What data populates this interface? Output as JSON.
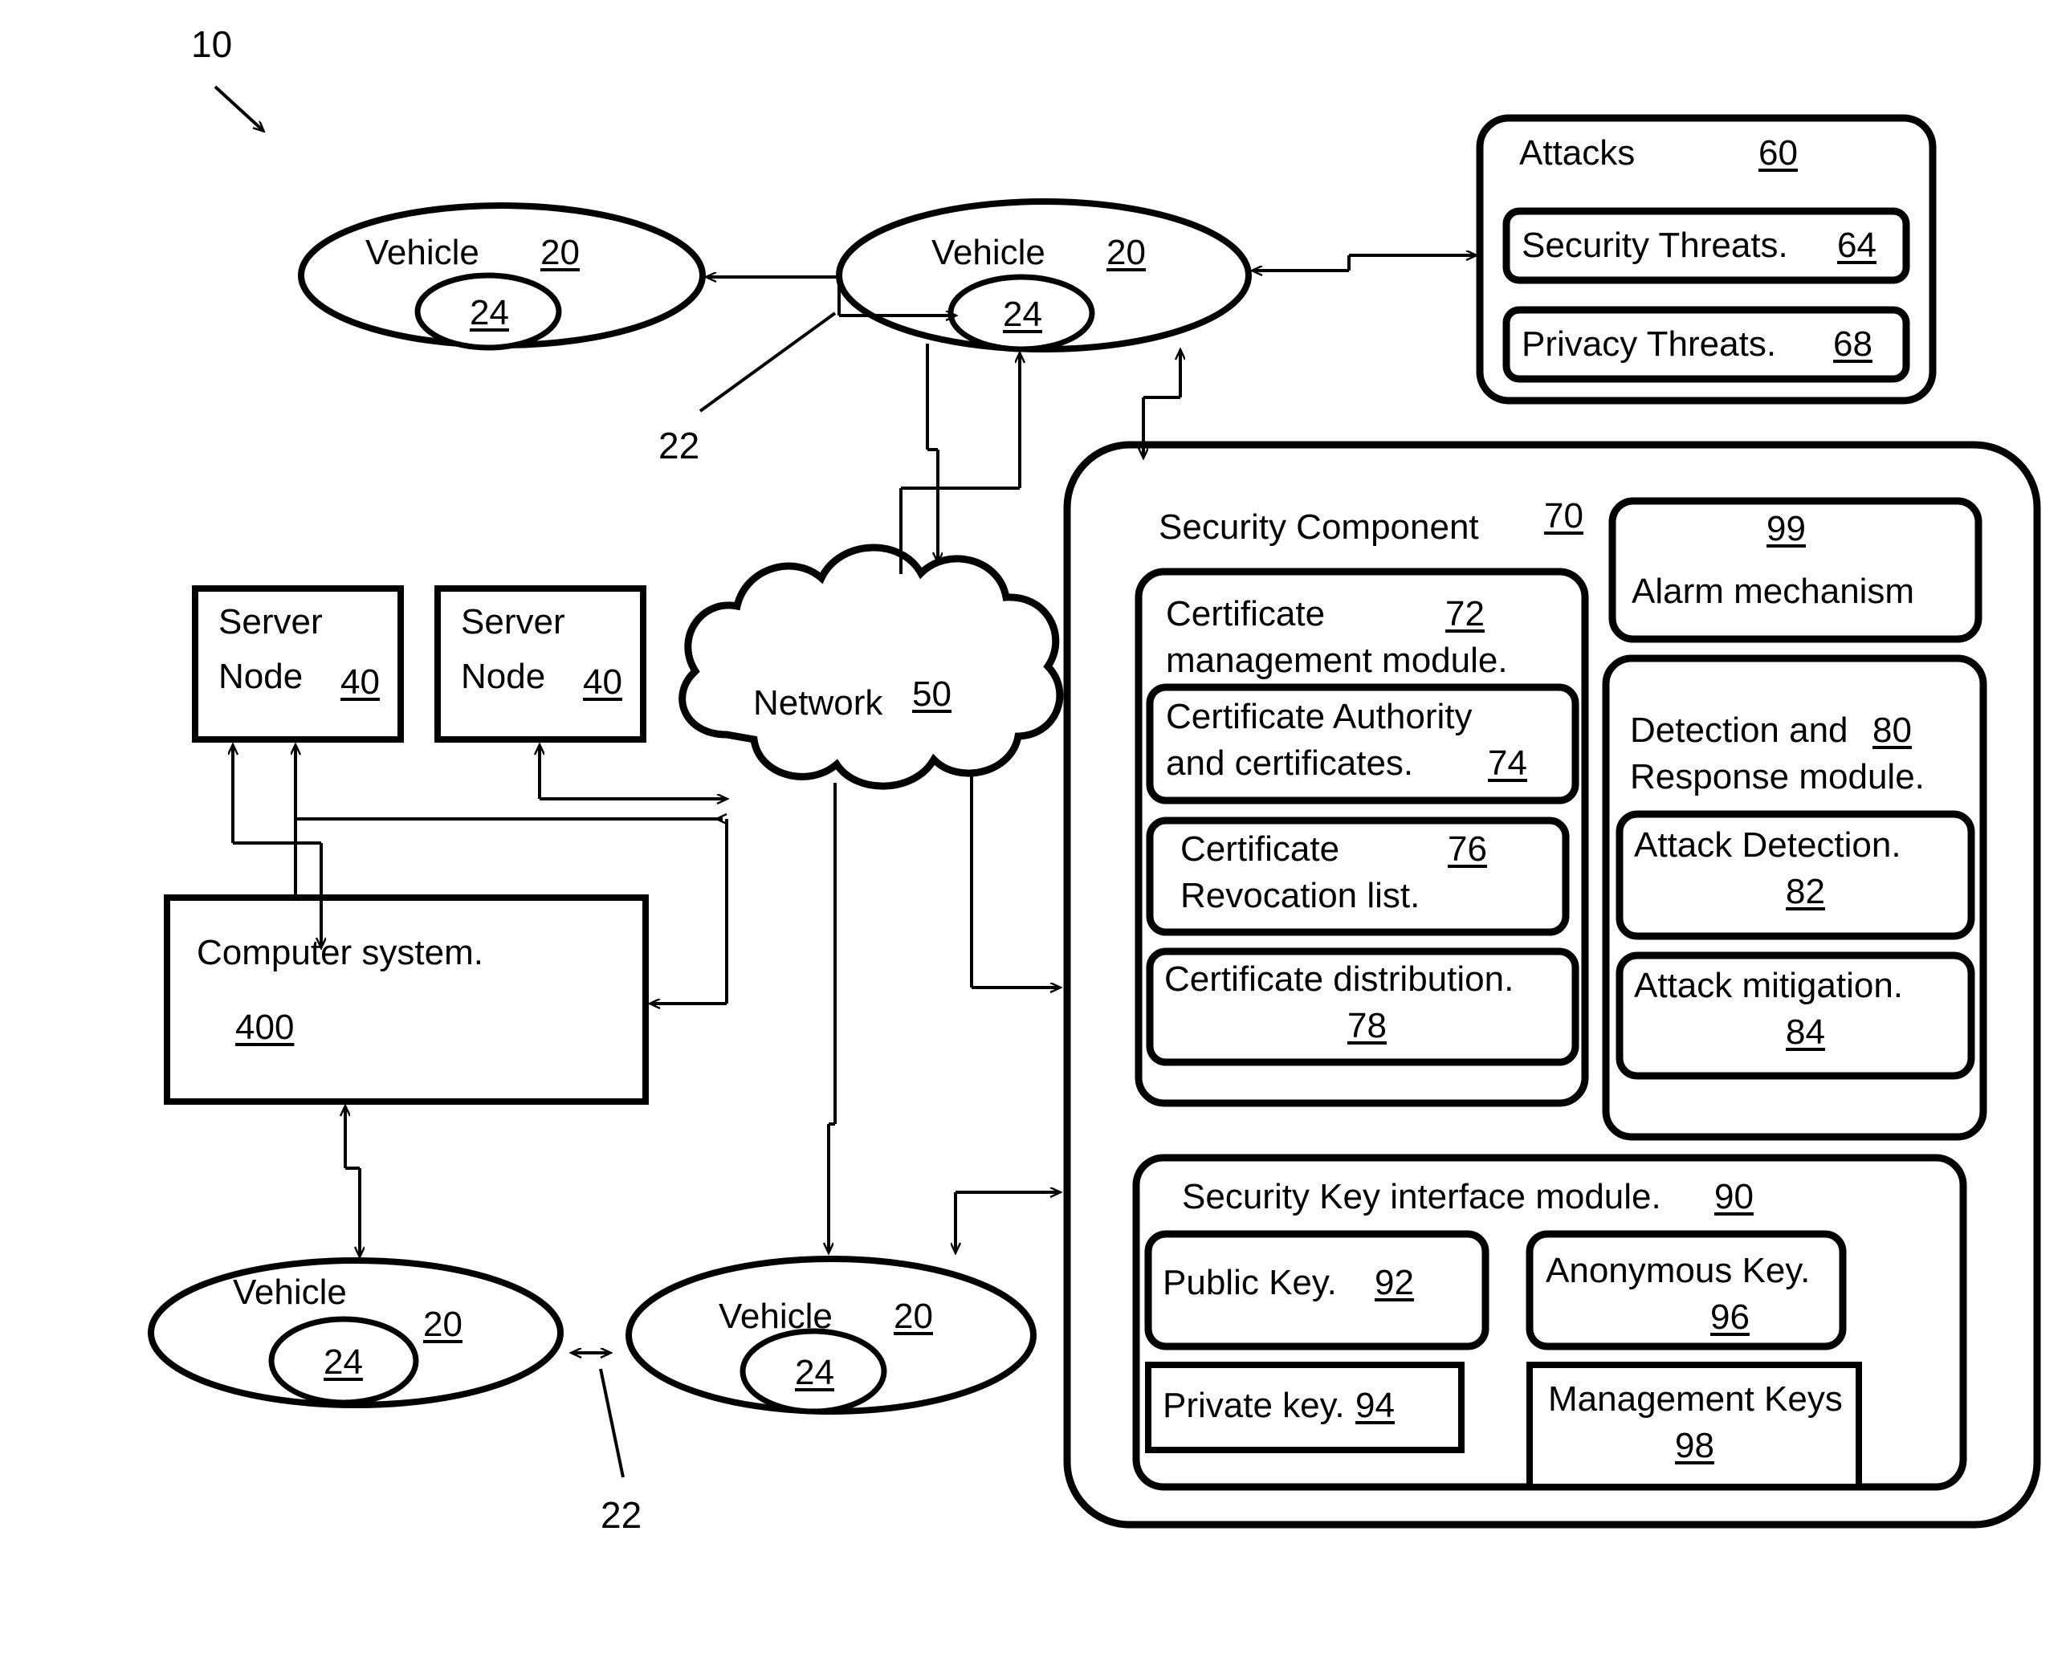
{
  "figure": {
    "ref_label": "10",
    "link_label_top": "22",
    "link_label_bottom": "22"
  },
  "vehicles": [
    {
      "id": "vehicle-top-left",
      "name": "Vehicle",
      "num": "20",
      "inner": "24"
    },
    {
      "id": "vehicle-top-middle",
      "name": "Vehicle",
      "num": "20",
      "inner": "24"
    },
    {
      "id": "vehicle-bottom-left",
      "name": "Vehicle",
      "num": "20",
      "inner": "24"
    },
    {
      "id": "vehicle-bottom-mid",
      "name": "Vehicle",
      "num": "20",
      "inner": "24"
    }
  ],
  "servers": [
    {
      "line1": "Server",
      "line2": "Node",
      "num": "40"
    },
    {
      "line1": "Server",
      "line2": "Node",
      "num": "40"
    }
  ],
  "computer_system": {
    "title": "Computer system.",
    "num": "400"
  },
  "network": {
    "title": "Network",
    "num": "50"
  },
  "attacks": {
    "title": "Attacks",
    "num": "60",
    "items": [
      {
        "label": "Security Threats.",
        "num": "64"
      },
      {
        "label": "Privacy Threats.",
        "num": "68"
      }
    ]
  },
  "security_component": {
    "title": "Security Component",
    "num": "70",
    "certificate_module": {
      "line1": "Certificate",
      "line2": "management module.",
      "num": "72",
      "items": [
        {
          "line1": "Certificate Authority",
          "line2": "and certificates.",
          "num": "74"
        },
        {
          "line1": "Certificate",
          "line2": "Revocation list.",
          "num": "76"
        },
        {
          "line1": "Certificate distribution.",
          "line2": "",
          "num": "78"
        }
      ]
    },
    "alarm": {
      "label": "Alarm mechanism",
      "num": "99"
    },
    "detection_module": {
      "line1": "Detection and",
      "line2": "Response module.",
      "num": "80",
      "items": [
        {
          "label": "Attack Detection.",
          "num": "82"
        },
        {
          "label": "Attack mitigation.",
          "num": "84"
        }
      ]
    },
    "key_module": {
      "title": "Security Key interface module.",
      "num": "90",
      "items": [
        {
          "label": "Public Key.",
          "num": "92",
          "shape": "rounded"
        },
        {
          "label": "Anonymous Key.",
          "num": "96",
          "shape": "rounded"
        },
        {
          "label": "Private key.",
          "num": "94",
          "shape": "square"
        },
        {
          "label": "Management Keys",
          "num": "98",
          "shape": "square"
        }
      ]
    }
  }
}
